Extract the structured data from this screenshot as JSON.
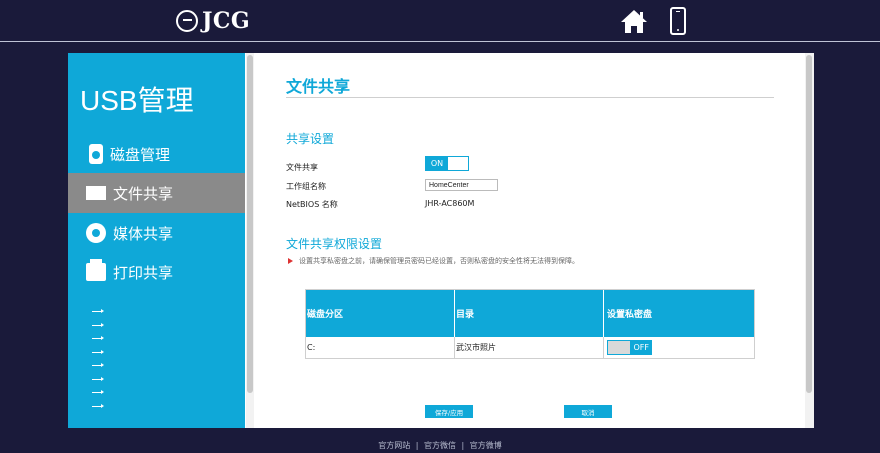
{
  "header": {
    "brand": "JCG",
    "home_icon": "home-icon",
    "mobile_icon": "mobile-phone-icon"
  },
  "sidebar": {
    "title": "USB管理",
    "items": [
      {
        "label": "磁盘管理",
        "icon": "disk-icon"
      },
      {
        "label": "文件共享",
        "icon": "file-share-icon"
      },
      {
        "label": "媒体共享",
        "icon": "media-share-icon"
      },
      {
        "label": "打印共享",
        "icon": "printer-icon"
      }
    ],
    "sub_items": [
      "",
      "",
      "",
      "",
      "",
      "",
      "",
      ""
    ]
  },
  "main": {
    "title": "文件共享",
    "share_settings": {
      "heading": "共享设置",
      "file_share_label": "文件共享",
      "file_share_state": "ON",
      "workgroup_label": "工作组名称",
      "workgroup_value": "HomeCenter",
      "netbios_label": "NetBIOS 名称",
      "netbios_value": "JHR-AC860M"
    },
    "permissions": {
      "heading": "文件共享权限设置",
      "warning": "设置共享私密盘之前，请确保管理员密码已经设置，否则私密盘的安全性将无法得到保障。",
      "columns": [
        "磁盘分区",
        "目录",
        "设置私密盘"
      ],
      "rows": [
        {
          "partition": "C:",
          "directory": "武汉市照片",
          "private_state": "OFF"
        }
      ]
    },
    "buttons": {
      "save": "保存/应用",
      "cancel": "取消"
    }
  },
  "footer": {
    "links": [
      "官方网站",
      "官方微信",
      "官方微博"
    ],
    "separator": "|"
  },
  "colors": {
    "accent": "#0fa8d8",
    "background": "#1a1a3a",
    "active_nav": "#8a8a8a"
  }
}
